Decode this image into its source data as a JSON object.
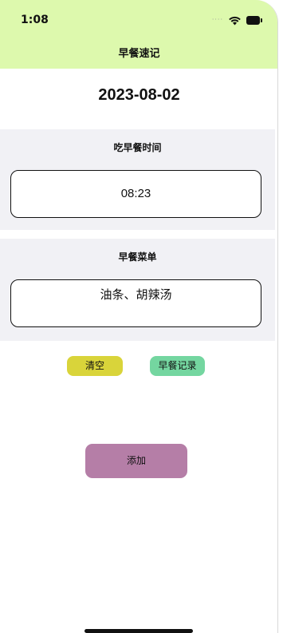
{
  "status_bar": {
    "time": "1:08",
    "signal": "····"
  },
  "nav": {
    "title": "早餐速记"
  },
  "date": "2023-08-02",
  "breakfast_time": {
    "label": "吃早餐时间",
    "value": "08:23"
  },
  "breakfast_menu": {
    "label": "早餐菜单",
    "value": "油条、胡辣汤"
  },
  "buttons": {
    "clear": "清空",
    "records": "早餐记录",
    "add": "添加"
  },
  "colors": {
    "topbar": "#ddf9ad",
    "section_bg": "#f1f1f5",
    "clear_button": "#d9d43a",
    "records_button": "#74d6a0",
    "add_button": "#b57ea7"
  }
}
